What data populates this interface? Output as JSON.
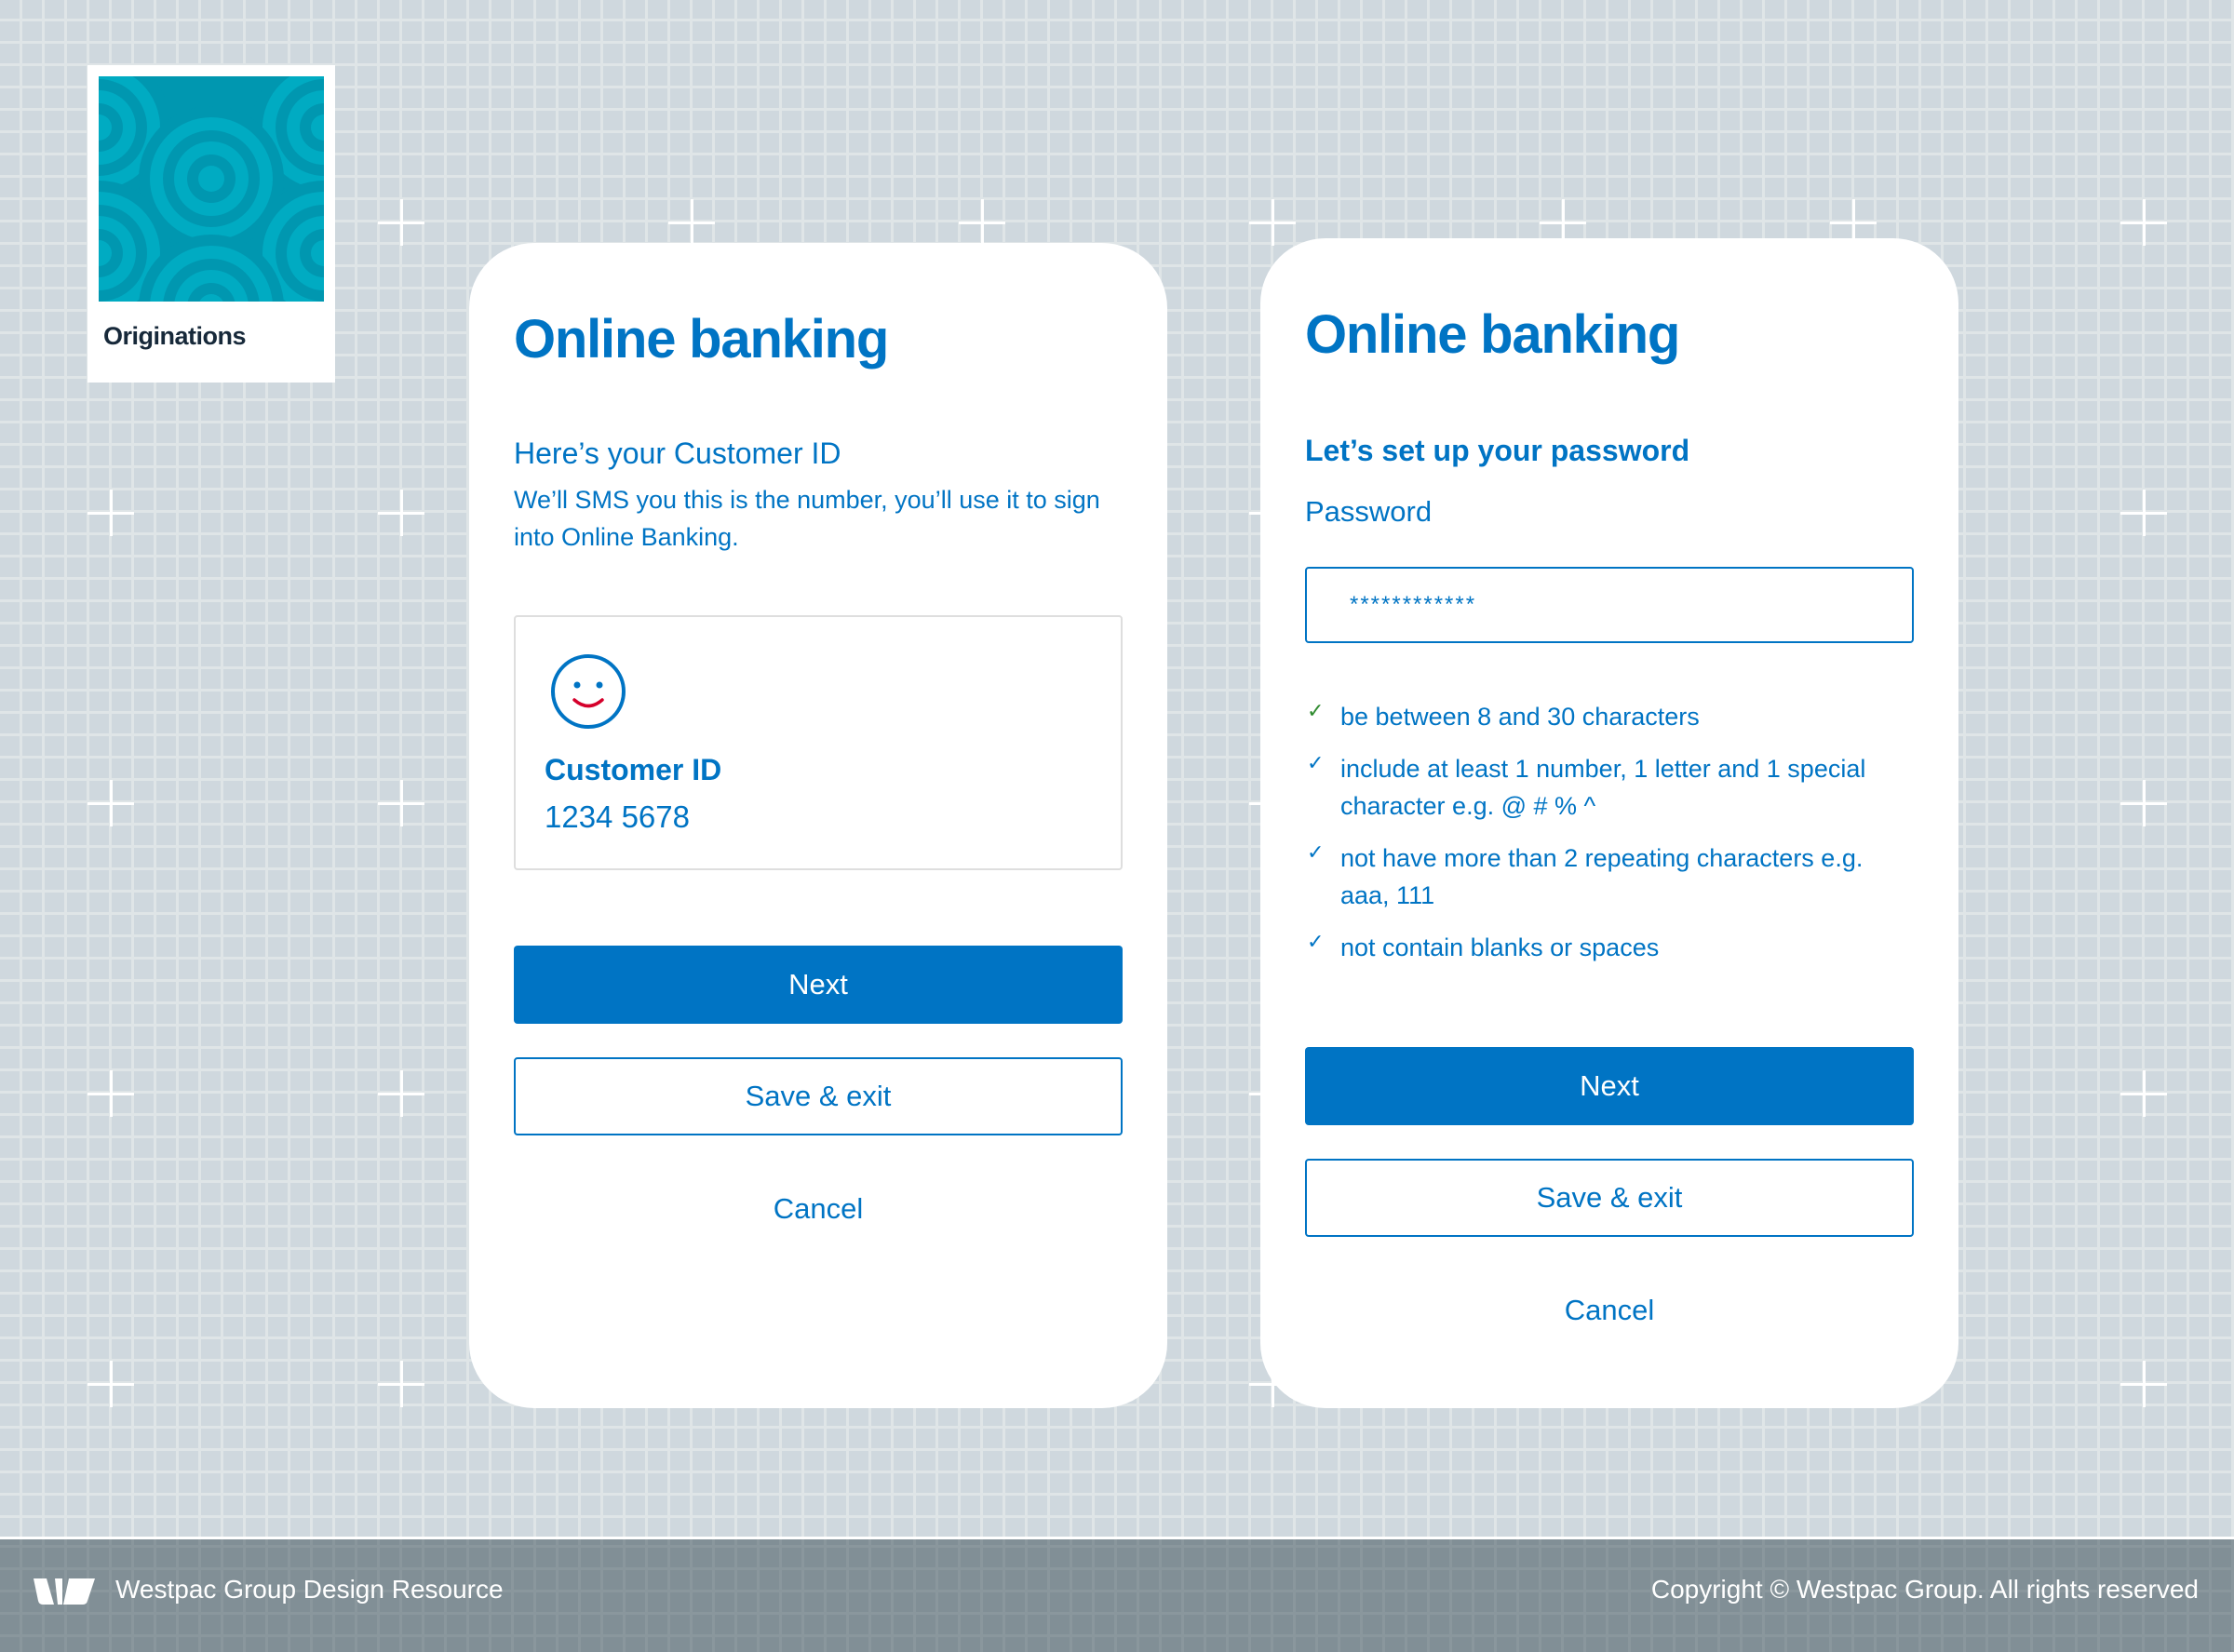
{
  "brand_tile": {
    "label": "Originations",
    "color": "#00a0b8"
  },
  "screens": [
    {
      "title": "Online banking",
      "subtitle": "Here’s your Customer ID",
      "description": "We’ll SMS you this is the number, you’ll use it to sign into Online Banking.",
      "id_card": {
        "icon": "smiley-icon",
        "label": "Customer ID",
        "value": "1234 5678"
      },
      "buttons": {
        "next": "Next",
        "save_exit": "Save & exit",
        "cancel": "Cancel"
      }
    },
    {
      "title": "Online banking",
      "subtitle": "Let’s set up your password",
      "password_label": "Password",
      "password_value": "************",
      "rules": [
        {
          "text": "be between 8 and 30 characters",
          "status": "met"
        },
        {
          "text": "include at least 1 number, 1 letter and 1 special character e.g. @ # % ^",
          "status": "pending"
        },
        {
          "text": "not have more than 2 repeating characters e.g. aaa, 111",
          "status": "pending"
        },
        {
          "text": "not contain blanks or spaces",
          "status": "pending"
        }
      ],
      "check_glyph": "✓",
      "buttons": {
        "next": "Next",
        "save_exit": "Save & exit",
        "cancel": "Cancel"
      }
    }
  ],
  "footer": {
    "brand": "Westpac Group Design Resource",
    "copyright": "Copyright © Westpac Group. All rights reserved"
  },
  "colors": {
    "primary": "#0074c4",
    "success": "#2e8a2e",
    "smile": "#d5002b",
    "footer_bg": "#818f96",
    "background": "#cfd8de"
  }
}
